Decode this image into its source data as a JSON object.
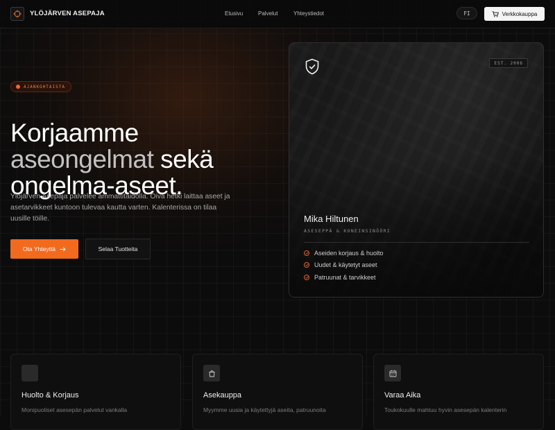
{
  "nav": {
    "brand": "YLÖJÄRVEN ASEPAJA",
    "logo_icon": "crosshair-icon",
    "links": [
      "Etusivu",
      "Palvelut",
      "Yhteystiedot"
    ],
    "language": "FI",
    "shop_label": "Verkkokauppa",
    "shop_icon": "cart-icon"
  },
  "hero": {
    "badge": "AJANKOHTAISTA",
    "headline_line1": "Korjaamme",
    "headline_highlight": "aseongelmat",
    "headline_line2_rest": "sekä",
    "headline_line3": "ongelma-aseet.",
    "lead": "Ylöjärven Asepaja palvelee ammattitaidolla. Oiva hetki laittaa aseet ja asetarvikkeet kuntoon tulevaa kautta varten. Kalenterissa on tilaa uusille töille.",
    "cta_primary": "Ota Yhteyttä",
    "cta_primary_icon": "arrow-right-icon",
    "cta_secondary": "Selaa Tuotteita"
  },
  "profile_card": {
    "icon": "shield-check-icon",
    "established": "EST. 2006",
    "name": "Mika Hiltunen",
    "role": "ASESEPPÄ & KONEINSINÖÖRI",
    "features": [
      "Aseiden korjaus & huolto",
      "Uudet & käytetyt aseet",
      "Patruunat & tarvikkeet"
    ],
    "accent_color": "#f26a1e"
  },
  "services": [
    {
      "title": "Huolto & Korjaus",
      "description": "Monipuoliset asesepän palvelut vankalla",
      "icon": "wrench-icon"
    },
    {
      "title": "Asekauppa",
      "description": "Myymme uusia ja käytettyjä aseita, patruunoita",
      "icon": "shopping-bag-icon"
    },
    {
      "title": "Varaa Aika",
      "description": "Toukokuulle mahtuu hyvin asesepän kalenterin",
      "icon": "calendar-icon"
    }
  ]
}
